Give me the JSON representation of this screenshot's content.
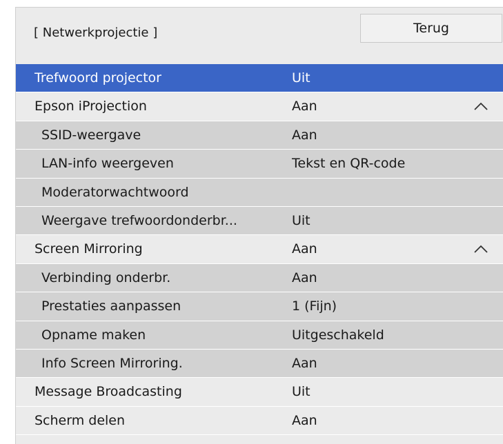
{
  "header": {
    "title": "[ Netwerkprojectie ]",
    "back_label": "Terug"
  },
  "rows": [
    {
      "label": "Trefwoord projector",
      "value": "Uit",
      "selected": true
    },
    {
      "label": "Epson iProjection",
      "value": "Aan",
      "expanded": true
    },
    {
      "label": "SSID-weergave",
      "value": "Aan"
    },
    {
      "label": "LAN-info weergeven",
      "value": "Tekst en QR-code"
    },
    {
      "label": "Moderatorwachtwoord",
      "value": ""
    },
    {
      "label": "Weergave trefwoordonderbr...",
      "value": "Uit"
    },
    {
      "label": "Screen Mirroring",
      "value": "Aan",
      "expanded": true
    },
    {
      "label": "Verbinding onderbr.",
      "value": "Aan"
    },
    {
      "label": "Prestaties aanpassen",
      "value": "1 (Fijn)"
    },
    {
      "label": "Opname maken",
      "value": "Uitgeschakeld"
    },
    {
      "label": "Info Screen Mirroring.",
      "value": "Aan"
    },
    {
      "label": "Message Broadcasting",
      "value": "Uit"
    },
    {
      "label": "Scherm delen",
      "value": "Aan"
    }
  ],
  "icons": {
    "expanded": "chevron-up-icon"
  },
  "colors": {
    "selected": "#3a65c6",
    "parent_bg": "#ebebeb",
    "child_bg": "#d2d2d2"
  }
}
